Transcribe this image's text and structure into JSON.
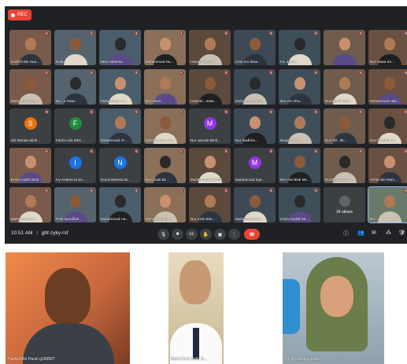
{
  "meet": {
    "rec_label": "REC",
    "time": "10:51 AM",
    "separator": "|",
    "meeting_code": "gbf-zyky-rsf",
    "others_label": "24 others",
    "participants": [
      "Hazlizil Bin Hus...",
      "Rudi...",
      "Wan Nafeesa",
      "Muhammad Nu...",
      "Hanani Zamri...",
      "Ceni Inn Ihwa...",
      "Fa..Jastin..",
      "...",
      "Nur Hawa Irn...",
      "Muhamad Nizz...",
      "Nu...a Swar...",
      "Muhammad Az...",
      "Nur Hazir...",
      "Hansah...ness...",
      "Muhamad Amiru...",
      "Nur Ain Afra...",
      "Nurafiqah Amir...",
      "Muhammad Hair...",
      "Siti Mariam Binti...",
      "Fariza Aini Binti ...",
      "Muhammad Al-...",
      "Maslina Kota E21...",
      "Nur Jannah Binti...",
      "Nur Nadhira...",
      "Busyra Hus...",
      "Nur Alif...Ibr...",
      "Nur Awadah Bi...",
      "Erina Hadlin Binti...",
      "Ivy Andrea Unus ...",
      "Nurul Masreta Bi...",
      "Nur Izzati Bt...",
      "Muhammad Harith...",
      "Muhammad Sya...",
      "Nor Aini Binti Mo...",
      "Nurafiqah Amir...",
      "Azhar Bin Ram...",
      "Muhammad Iz...",
      "Putri Nurafifah...",
      "Muhammad Ha...",
      "Mimie Suhadi...",
      "Nur Azlin Bint...",
      "Muhammad Zul...",
      "Izzah Nadiah Bi..."
    ],
    "last_tile_name": "Ro..."
  },
  "videos": [
    {
      "name": "Hazlizil Bin Husin g16950?"
    },
    {
      "name": "Mohd Dzul Hafiz B..."
    },
    {
      "name": "Dr. Norashikin Fauzi"
    }
  ]
}
